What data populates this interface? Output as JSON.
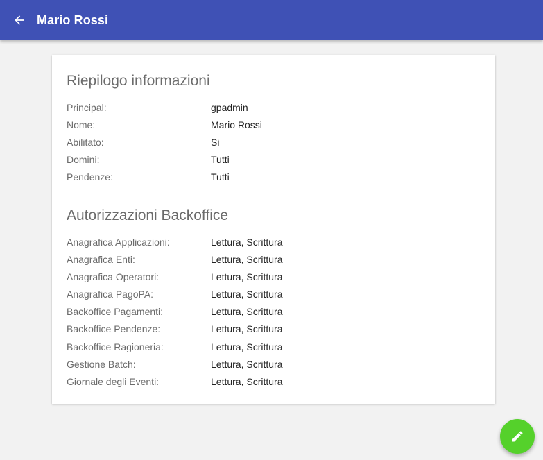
{
  "header": {
    "title": "Mario Rossi",
    "back_icon": "arrow-back-icon",
    "background_color": "#3f51b5"
  },
  "summary": {
    "title": "Riepilogo informazioni",
    "rows": [
      {
        "label": "Principal:",
        "value": "gpadmin"
      },
      {
        "label": "Nome:",
        "value": "Mario Rossi"
      },
      {
        "label": "Abilitato:",
        "value": "Si"
      },
      {
        "label": "Domini:",
        "value": "Tutti"
      },
      {
        "label": "Pendenze:",
        "value": "Tutti"
      }
    ]
  },
  "backoffice": {
    "title": "Autorizzazioni Backoffice",
    "rows": [
      {
        "label": "Anagrafica Applicazioni:",
        "value": "Lettura, Scrittura"
      },
      {
        "label": "Anagrafica Enti:",
        "value": "Lettura, Scrittura"
      },
      {
        "label": "Anagrafica Operatori:",
        "value": "Lettura, Scrittura"
      },
      {
        "label": "Anagrafica PagoPA:",
        "value": "Lettura, Scrittura"
      },
      {
        "label": "Backoffice Pagamenti:",
        "value": "Lettura, Scrittura"
      },
      {
        "label": "Backoffice Pendenze:",
        "value": "Lettura, Scrittura"
      },
      {
        "label": "Backoffice Ragioneria:",
        "value": "Lettura, Scrittura"
      },
      {
        "label": "Gestione Batch:",
        "value": "Lettura, Scrittura"
      },
      {
        "label": "Giornale degli Eventi:",
        "value": "Lettura, Scrittura"
      }
    ]
  },
  "fab": {
    "icon": "edit-pencil-icon",
    "color": "#55d12b"
  }
}
